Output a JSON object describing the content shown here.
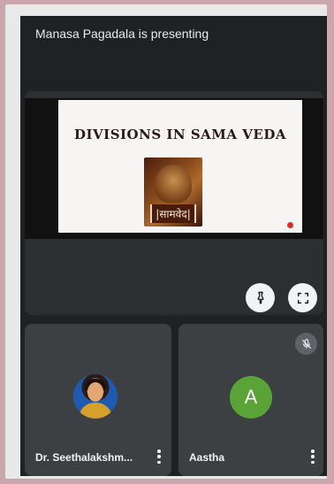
{
  "presentation": {
    "banner": "Manasa Pagadala is presenting",
    "slide_title": "DIVISIONS IN SAMA VEDA",
    "book_label": "|सामवेद|"
  },
  "controls": {
    "pin_icon": "pin-icon",
    "fullscreen_icon": "fullscreen-icon"
  },
  "participants": [
    {
      "name": "Dr. Seethalakshm...",
      "avatar": "photo",
      "muted": false
    },
    {
      "name": "Aastha",
      "avatar_letter": "A",
      "avatar_color": "#5aa437",
      "muted": true
    }
  ],
  "colors": {
    "background": "#202124",
    "tile": "#3c4043",
    "recording_dot": "#d93025"
  }
}
